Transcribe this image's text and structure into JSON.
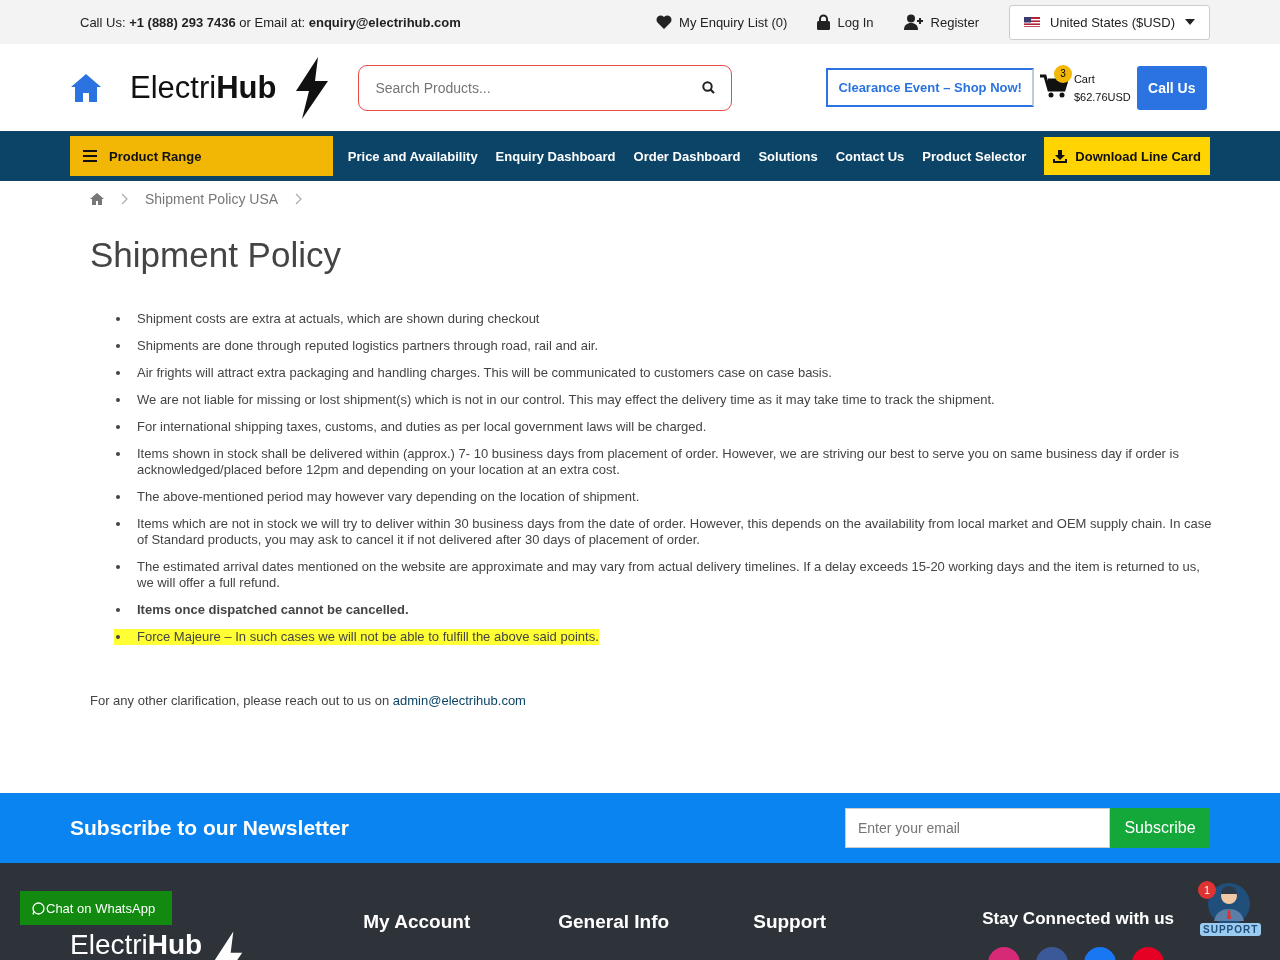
{
  "top_bar": {
    "call_label": "Call Us:",
    "phone": "+1 (888) 293 7436",
    "email_label": "or Email at:",
    "email": "enquiry@electrihub.com",
    "links": [
      {
        "kind": "heart",
        "label": "My Enquiry List (0)"
      },
      {
        "kind": "lock",
        "label": "Log In"
      },
      {
        "kind": "user",
        "label": "Register"
      }
    ],
    "currency": "United States ($USD)"
  },
  "header": {
    "logo_light": "Electri",
    "logo_bold": "Hub",
    "search": {
      "placeholder": "Search Products..."
    },
    "promo": "Clearance Event – Shop Now!",
    "cart": {
      "count": "3",
      "label": "Cart",
      "total": "$62.76USD"
    },
    "call_button": "Call Us"
  },
  "nav": {
    "product_range": "Product Range",
    "items": [
      "Price and Availability",
      "Enquiry Dashboard",
      "Order Dashboard",
      "Solutions",
      "Contact Us",
      "Product Selector"
    ],
    "download": "Download Line Card"
  },
  "breadcrumb": [
    "Shipment Policy USA"
  ],
  "title": "Shipment Policy",
  "bullets": [
    {
      "kind": "plain",
      "text": "Shipment costs are extra at actuals, which are shown during checkout"
    },
    {
      "kind": "plain",
      "text": "Shipments are done through reputed logistics partners through road, rail and air."
    },
    {
      "kind": "plain",
      "text": "Air frights will attract extra packaging and handling charges. This will be communicated to customers case on case basis."
    },
    {
      "kind": "plain",
      "text": "We are not liable for missing or lost shipment(s) which is not in our control. This may effect the delivery time as it may take time to track the shipment."
    },
    {
      "kind": "plain",
      "text": "For international shipping taxes, customs, and duties as per local government laws will be charged."
    },
    {
      "kind": "plain",
      "text": "Items shown in stock shall be delivered within (approx.) 7- 10 business days from placement of order. However, we are striving our best to serve you on same business day if order is acknowledged/placed before 12pm and depending on your location at an extra cost."
    },
    {
      "kind": "plain",
      "text": "The above-mentioned period may however vary depending on the location of shipment."
    },
    {
      "kind": "plain",
      "text": "Items which are not in stock we will try to deliver within 30 business days from the date of order. However, this depends on the availability from local market and OEM supply chain. In case of Standard products, you may ask to cancel it if not delivered after 30 days of placement of order."
    },
    {
      "kind": "plain",
      "text": "The estimated arrival dates mentioned on the website are approximate and may vary from actual delivery timelines. If a delay exceeds 15-20 working days and the item is returned to us, we will offer a full refund."
    },
    {
      "kind": "bold",
      "text": "Items once dispatched cannot be cancelled."
    },
    {
      "kind": "highlight",
      "text": "Force Majeure – In such cases we will not be able to fulfill the above said points."
    }
  ],
  "note": {
    "text": "For any other clarification, please reach out to us on",
    "email": "admin@electrihub.com"
  },
  "newsletter": {
    "title": "Subscribe to our Newsletter",
    "email_field": {
      "placeholder": "Enter your email"
    },
    "button": "Subscribe"
  },
  "footer": {
    "logo_light": "Electri",
    "logo_bold": "Hub",
    "headings": [
      "My Account",
      "General Info",
      "Support",
      "Stay Connected with us"
    ],
    "socials": [
      {
        "color": "#d62976"
      },
      {
        "color": "#3b5998"
      },
      {
        "color": "#1877f2"
      },
      {
        "color": "#e60023"
      }
    ]
  },
  "whatsapp": "Chat on WhatsApp",
  "support_widget": {
    "badge": "1",
    "label": "SUPPORT"
  }
}
